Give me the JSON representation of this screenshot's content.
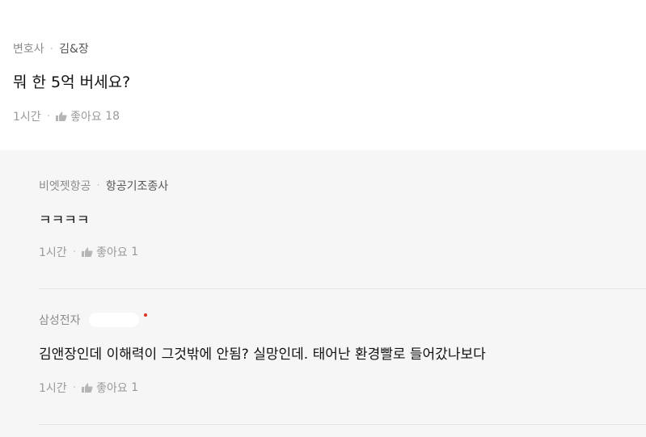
{
  "post": {
    "company": "변호사",
    "job": "김&장",
    "content": "뭐 한 5억 버세요?",
    "time": "1시간",
    "like_label": "좋아요",
    "like_count": "18"
  },
  "replies": [
    {
      "company": "비엣젯항공",
      "job": "항공기조종사",
      "content": "ㅋㅋㅋㅋ",
      "time": "1시간",
      "like_label": "좋아요",
      "like_count": "1"
    },
    {
      "company": "삼성전자",
      "job": "",
      "content": "김앤장인데 이해력이 그것밖에 안됨? 실망인데. 태어난 환경빨로 들어갔나보다",
      "time": "1시간",
      "like_label": "좋아요",
      "like_count": "1"
    }
  ],
  "separator": "·",
  "icons": {
    "like": "thumbs-up-icon",
    "verified": "red-dot-icon"
  },
  "colors": {
    "reply_background": "#f6f6f6",
    "meta_text": "#9a9a9a",
    "verified_dot": "#e0301e"
  }
}
